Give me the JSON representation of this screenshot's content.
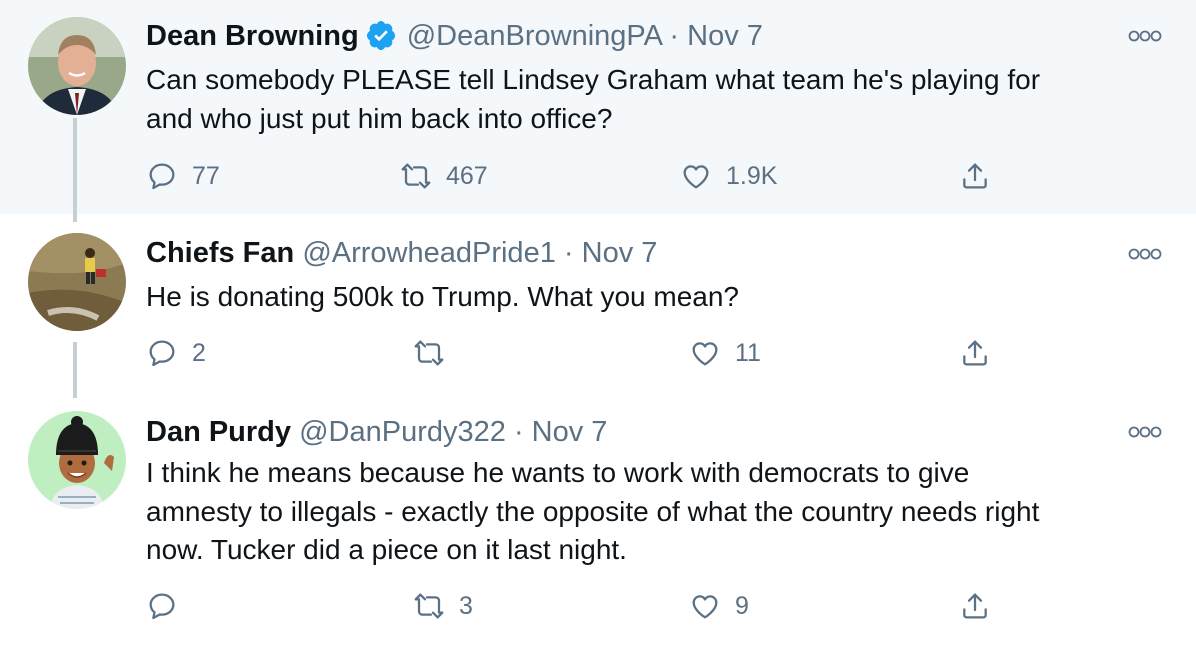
{
  "tweets": [
    {
      "name": "Dean Browning",
      "verified": true,
      "handle": "@DeanBrowningPA",
      "separator": "·",
      "date": "Nov 7",
      "text_lines": [
        "Can somebody PLEASE tell Lindsey Graham what team he's playing for",
        "and who just put him back into office?"
      ],
      "replies": "77",
      "retweets": "467",
      "likes": "1.9K",
      "highlighted": true
    },
    {
      "name": "Chiefs Fan",
      "verified": false,
      "handle": "@ArrowheadPride1",
      "separator": "·",
      "date": "Nov 7",
      "text_lines": [
        "He is donating 500k to Trump. What you mean?"
      ],
      "replies": "2",
      "retweets": "",
      "likes": "11"
    },
    {
      "name": "Dan Purdy",
      "verified": false,
      "handle": "@DanPurdy322",
      "separator": "·",
      "date": "Nov 7",
      "text_lines": [
        "I think he means because he wants to work with democrats to give",
        "amnesty to illegals - exactly the opposite of what the country needs right",
        "now. Tucker did a piece on it last night."
      ],
      "replies": "",
      "retweets": "3",
      "likes": "9"
    }
  ],
  "icons": {
    "reply": "reply-icon",
    "retweet": "retweet-icon",
    "like": "heart-icon",
    "share": "share-icon",
    "more": "more-icon",
    "verified": "verified-badge-icon"
  },
  "colors": {
    "highlight_bg": "#f5f8fa",
    "secondary_text": "#5b7083",
    "verified_blue": "#1da1f2",
    "thread_line": "#c4cfd6"
  }
}
